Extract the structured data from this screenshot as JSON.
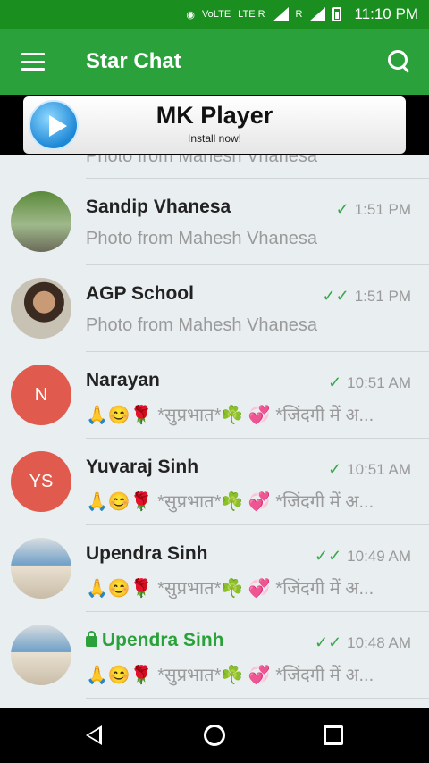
{
  "status_bar": {
    "time": "11:10 PM",
    "volte": "VoLTE",
    "lte": "LTE R",
    "roaming": "R"
  },
  "app_bar": {
    "title": "Star Chat",
    "icons": [
      "menu-icon",
      "search-icon"
    ]
  },
  "ad": {
    "title": "MK Player",
    "subtitle": "Install now!"
  },
  "chats": {
    "partial_snippet": "Photo from Mahesh Vhanesa",
    "items": [
      {
        "name": "Sandip Vhanesa",
        "time": "1:51 PM",
        "snippet": "Photo from Mahesh Vhanesa",
        "ticks": "✓",
        "avatar": "photo"
      },
      {
        "name": "AGP School",
        "time": "1:51 PM",
        "snippet": "Photo from Mahesh Vhanesa",
        "ticks": "✓✓",
        "avatar": "photo"
      },
      {
        "name": "Narayan",
        "time": "10:51 AM",
        "snippet": "🙏😊🌹 *सुप्रभात*☘️  💞 *जिंदगी में अ...",
        "ticks": "✓",
        "avatar": "N"
      },
      {
        "name": "Yuvaraj Sinh",
        "time": "10:51 AM",
        "snippet": "🙏😊🌹 *सुप्रभात*☘️  💞 *जिंदगी में अ...",
        "ticks": "✓",
        "avatar": "YS"
      },
      {
        "name": "Upendra Sinh",
        "time": "10:49 AM",
        "snippet": "🙏😊🌹 *सुप्रभात*☘️  💞 *जिंदगी में अ...",
        "ticks": "✓✓",
        "avatar": "photo"
      },
      {
        "name": "Upendra Sinh",
        "time": "10:48 AM",
        "snippet": "🙏😊🌹 *सुप्रभात*☘️  💞 *जिंदगी में अ...",
        "ticks": "✓✓",
        "avatar": "photo",
        "secret": true
      }
    ]
  },
  "colors": {
    "accent": "#2aa13a",
    "status_bar": "#1a8f1f",
    "initial_avatar": "#e05b4d"
  }
}
